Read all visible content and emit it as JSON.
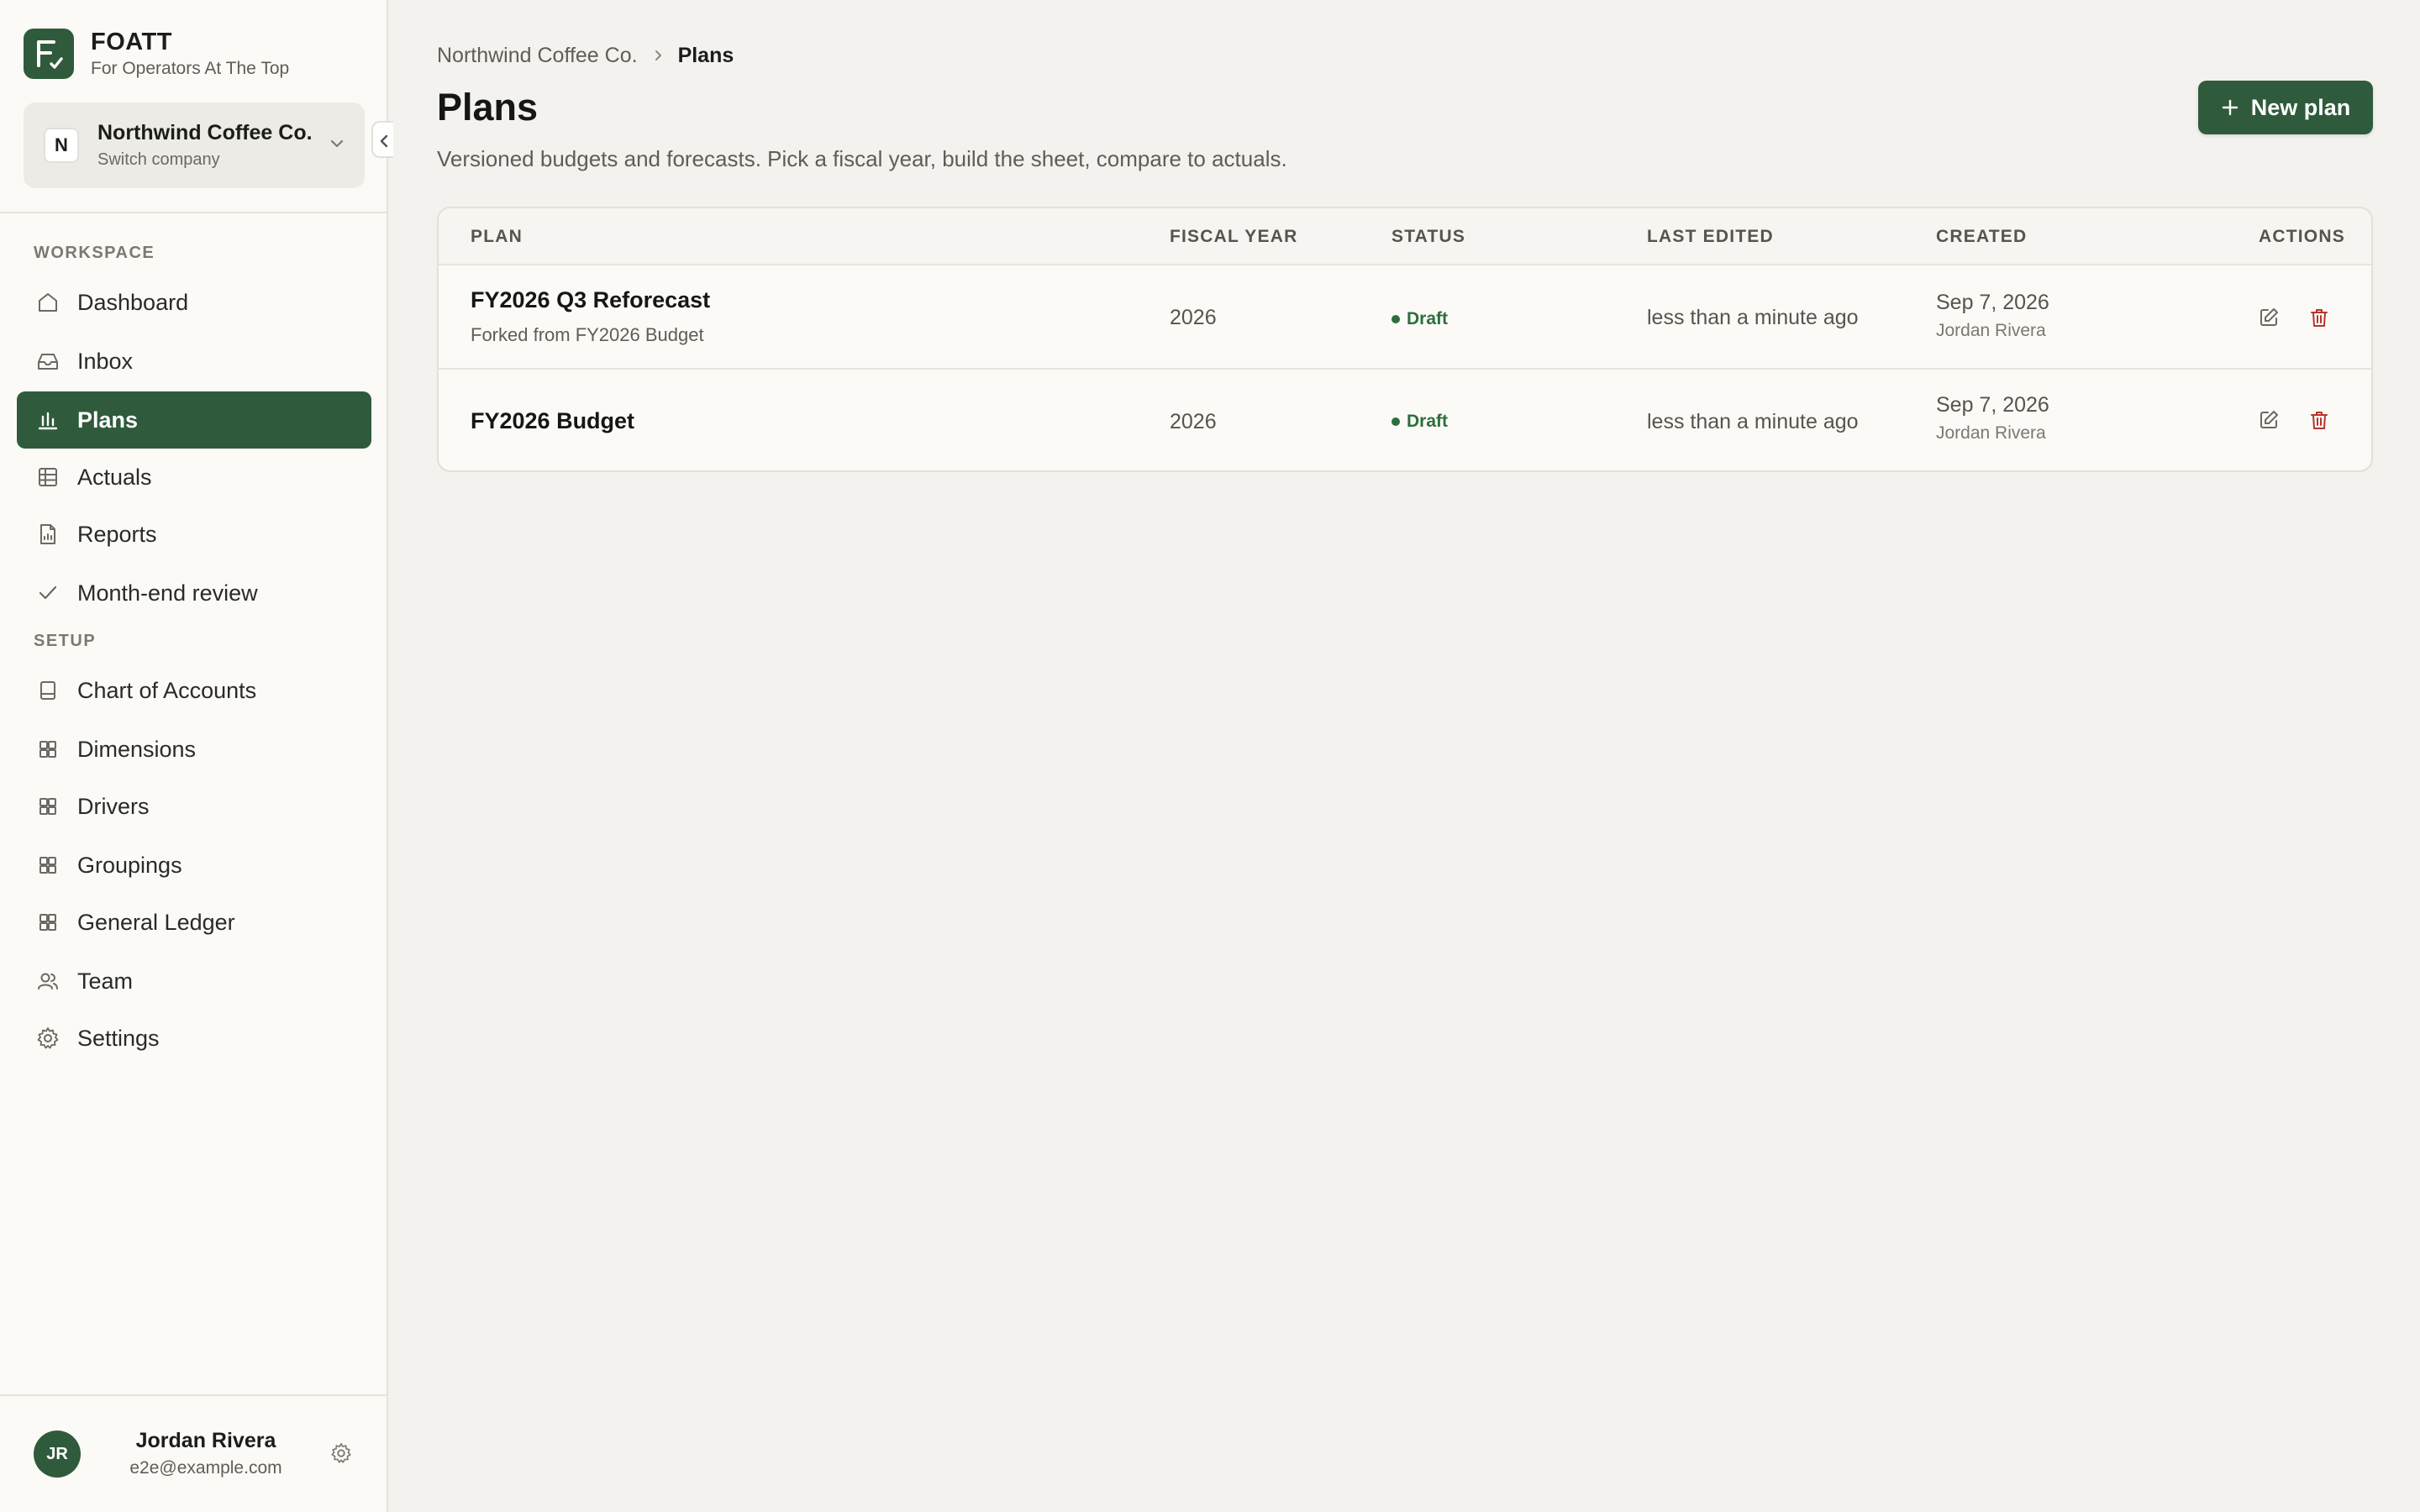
{
  "brand": {
    "name": "FOATT",
    "tagline": "For Operators At The Top",
    "logo_icon": "logo-f-check-icon"
  },
  "company": {
    "initial": "N",
    "name": "Northwind Coffee Co.",
    "sub": "Switch company"
  },
  "sidebar": {
    "workspace_label": "WORKSPACE",
    "setup_label": "SETUP",
    "workspace_items": [
      {
        "label": "Dashboard",
        "icon": "home-icon"
      },
      {
        "label": "Inbox",
        "icon": "inbox-icon"
      },
      {
        "label": "Plans",
        "icon": "bar-chart-icon",
        "active": true
      },
      {
        "label": "Actuals",
        "icon": "table-icon"
      },
      {
        "label": "Reports",
        "icon": "report-icon"
      },
      {
        "label": "Month-end review",
        "icon": "check-icon"
      }
    ],
    "setup_items": [
      {
        "label": "Chart of Accounts",
        "icon": "book-icon"
      },
      {
        "label": "Dimensions",
        "icon": "grid-icon"
      },
      {
        "label": "Drivers",
        "icon": "grid-icon"
      },
      {
        "label": "Groupings",
        "icon": "grid-icon"
      },
      {
        "label": "General Ledger",
        "icon": "grid-icon"
      },
      {
        "label": "Team",
        "icon": "users-icon"
      },
      {
        "label": "Settings",
        "icon": "gear-icon"
      }
    ]
  },
  "user": {
    "initials": "JR",
    "name": "Jordan Rivera",
    "email": "e2e@example.com"
  },
  "breadcrumb": {
    "parent": "Northwind Coffee Co.",
    "current": "Plans"
  },
  "page": {
    "title": "Plans",
    "subtitle": "Versioned budgets and forecasts. Pick a fiscal year, build the sheet, compare to actuals.",
    "new_button": "New plan"
  },
  "table": {
    "columns": [
      "PLAN",
      "FISCAL YEAR",
      "STATUS",
      "LAST EDITED",
      "CREATED",
      "ACTIONS"
    ],
    "rows": [
      {
        "name": "FY2026 Q3 Reforecast",
        "forked_from": "Forked from FY2026 Budget",
        "fiscal_year": "2026",
        "status": "Draft",
        "last_edited": "less than a minute ago",
        "created_date": "Sep 7, 2026",
        "created_by": "Jordan Rivera"
      },
      {
        "name": "FY2026 Budget",
        "fiscal_year": "2026",
        "status": "Draft",
        "last_edited": "less than a minute ago",
        "created_date": "Sep 7, 2026",
        "created_by": "Jordan Rivera"
      }
    ]
  },
  "colors": {
    "accent": "#2f5b3c",
    "status_draft": "#2c6e3f",
    "delete": "#b8342a"
  }
}
